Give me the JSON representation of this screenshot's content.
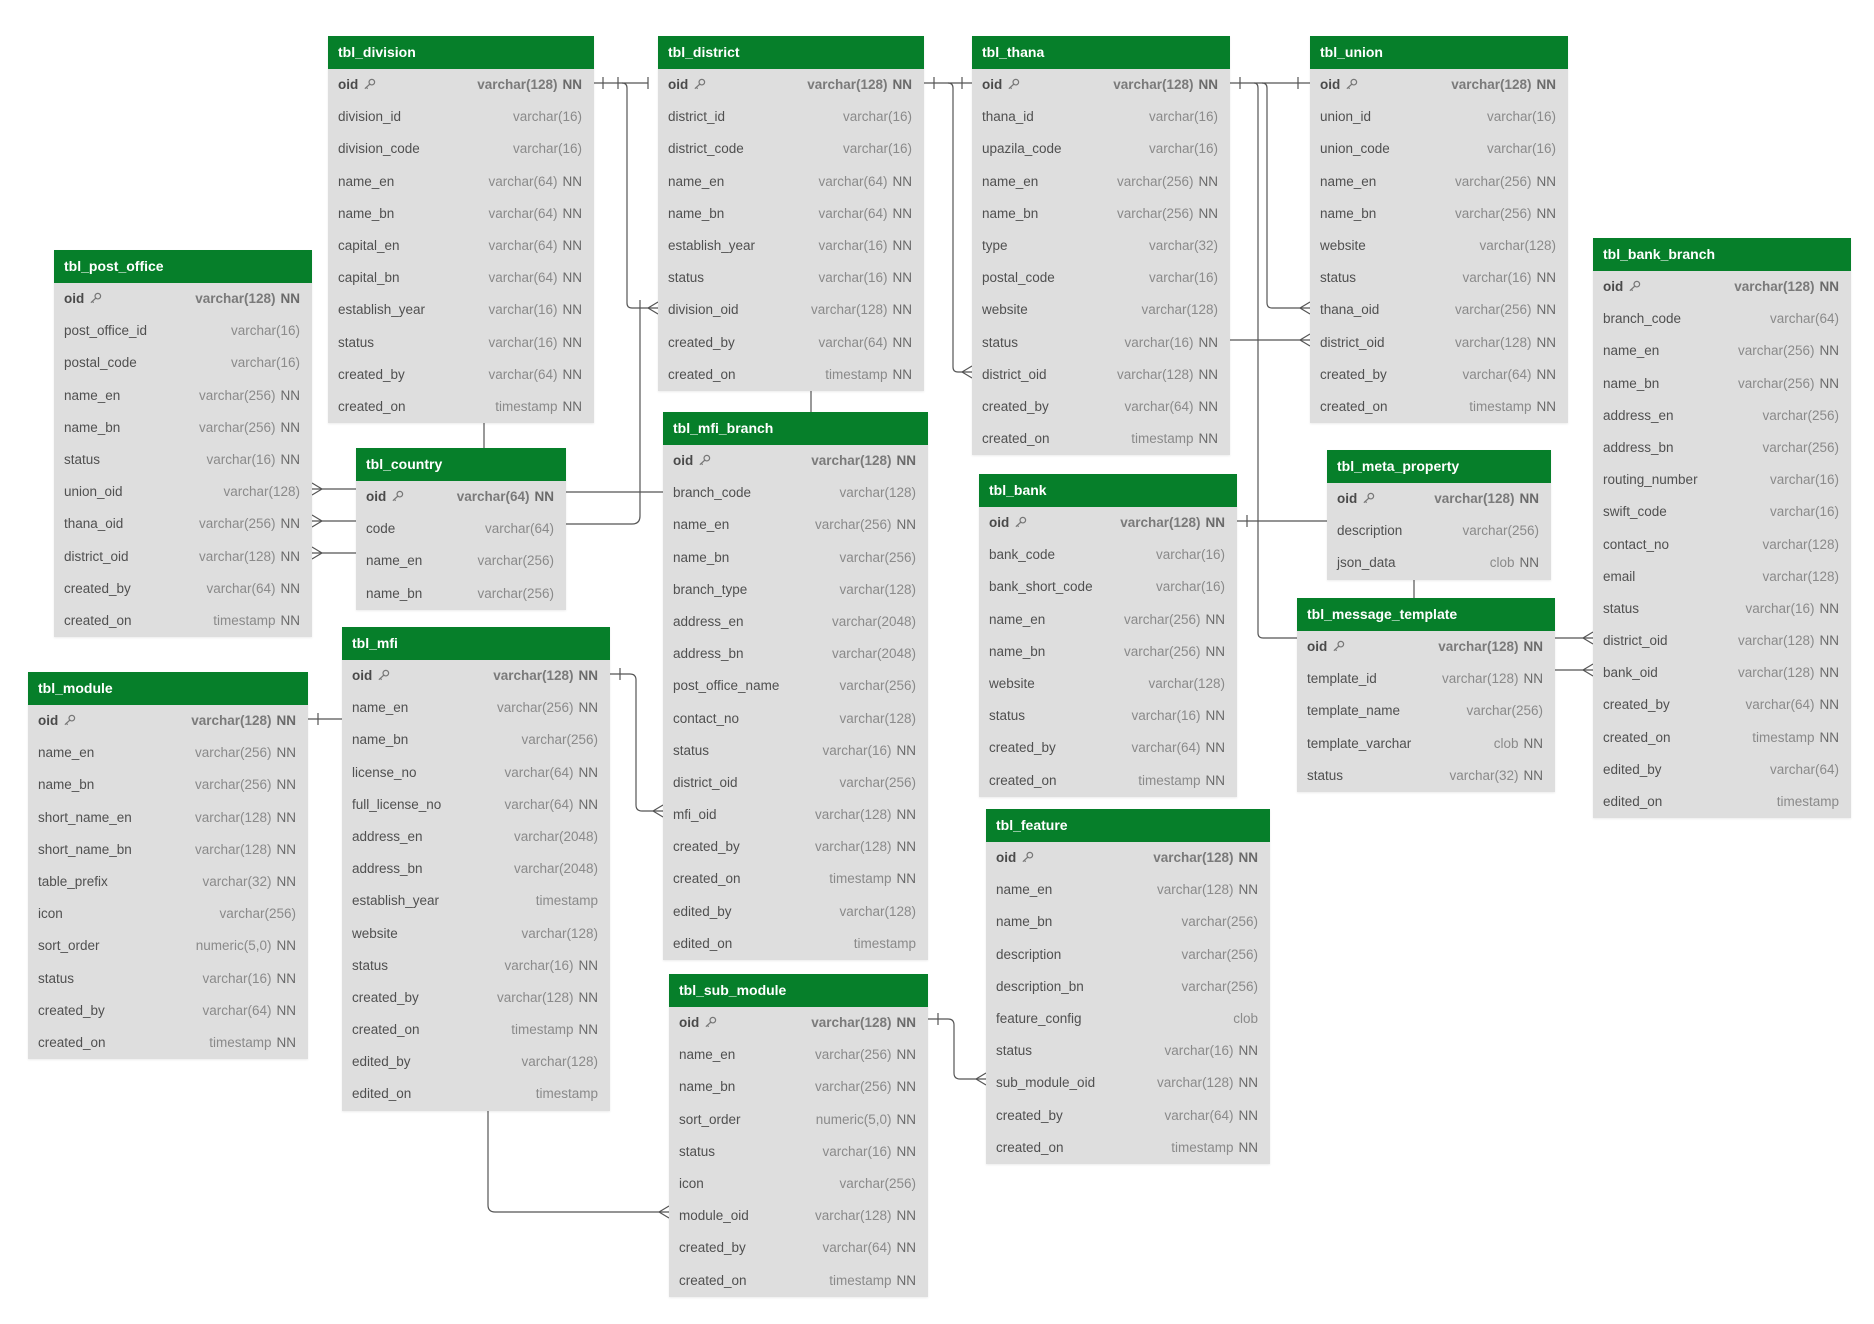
{
  "tables": [
    {
      "id": "tbl_division",
      "name": "tbl_division",
      "columns": [
        {
          "name": "oid",
          "type": "varchar(128)",
          "nn": "NN",
          "pk": true
        },
        {
          "name": "division_id",
          "type": "varchar(16)",
          "nn": ""
        },
        {
          "name": "division_code",
          "type": "varchar(16)",
          "nn": ""
        },
        {
          "name": "name_en",
          "type": "varchar(64)",
          "nn": "NN"
        },
        {
          "name": "name_bn",
          "type": "varchar(64)",
          "nn": "NN"
        },
        {
          "name": "capital_en",
          "type": "varchar(64)",
          "nn": "NN"
        },
        {
          "name": "capital_bn",
          "type": "varchar(64)",
          "nn": "NN"
        },
        {
          "name": "establish_year",
          "type": "varchar(16)",
          "nn": "NN"
        },
        {
          "name": "status",
          "type": "varchar(16)",
          "nn": "NN"
        },
        {
          "name": "created_by",
          "type": "varchar(64)",
          "nn": "NN"
        },
        {
          "name": "created_on",
          "type": "timestamp",
          "nn": "NN"
        }
      ]
    },
    {
      "id": "tbl_district",
      "name": "tbl_district",
      "columns": [
        {
          "name": "oid",
          "type": "varchar(128)",
          "nn": "NN",
          "pk": true
        },
        {
          "name": "district_id",
          "type": "varchar(16)",
          "nn": ""
        },
        {
          "name": "district_code",
          "type": "varchar(16)",
          "nn": ""
        },
        {
          "name": "name_en",
          "type": "varchar(64)",
          "nn": "NN"
        },
        {
          "name": "name_bn",
          "type": "varchar(64)",
          "nn": "NN"
        },
        {
          "name": "establish_year",
          "type": "varchar(16)",
          "nn": "NN"
        },
        {
          "name": "status",
          "type": "varchar(16)",
          "nn": "NN"
        },
        {
          "name": "division_oid",
          "type": "varchar(128)",
          "nn": "NN"
        },
        {
          "name": "created_by",
          "type": "varchar(64)",
          "nn": "NN"
        },
        {
          "name": "created_on",
          "type": "timestamp",
          "nn": "NN"
        }
      ]
    },
    {
      "id": "tbl_thana",
      "name": "tbl_thana",
      "columns": [
        {
          "name": "oid",
          "type": "varchar(128)",
          "nn": "NN",
          "pk": true
        },
        {
          "name": "thana_id",
          "type": "varchar(16)",
          "nn": ""
        },
        {
          "name": "upazila_code",
          "type": "varchar(16)",
          "nn": ""
        },
        {
          "name": "name_en",
          "type": "varchar(256)",
          "nn": "NN"
        },
        {
          "name": "name_bn",
          "type": "varchar(256)",
          "nn": "NN"
        },
        {
          "name": "type",
          "type": "varchar(32)",
          "nn": ""
        },
        {
          "name": "postal_code",
          "type": "varchar(16)",
          "nn": ""
        },
        {
          "name": "website",
          "type": "varchar(128)",
          "nn": ""
        },
        {
          "name": "status",
          "type": "varchar(16)",
          "nn": "NN"
        },
        {
          "name": "district_oid",
          "type": "varchar(128)",
          "nn": "NN"
        },
        {
          "name": "created_by",
          "type": "varchar(64)",
          "nn": "NN"
        },
        {
          "name": "created_on",
          "type": "timestamp",
          "nn": "NN"
        }
      ]
    },
    {
      "id": "tbl_union",
      "name": "tbl_union",
      "columns": [
        {
          "name": "oid",
          "type": "varchar(128)",
          "nn": "NN",
          "pk": true
        },
        {
          "name": "union_id",
          "type": "varchar(16)",
          "nn": ""
        },
        {
          "name": "union_code",
          "type": "varchar(16)",
          "nn": ""
        },
        {
          "name": "name_en",
          "type": "varchar(256)",
          "nn": "NN"
        },
        {
          "name": "name_bn",
          "type": "varchar(256)",
          "nn": "NN"
        },
        {
          "name": "website",
          "type": "varchar(128)",
          "nn": ""
        },
        {
          "name": "status",
          "type": "varchar(16)",
          "nn": "NN"
        },
        {
          "name": "thana_oid",
          "type": "varchar(256)",
          "nn": "NN"
        },
        {
          "name": "district_oid",
          "type": "varchar(128)",
          "nn": "NN"
        },
        {
          "name": "created_by",
          "type": "varchar(64)",
          "nn": "NN"
        },
        {
          "name": "created_on",
          "type": "timestamp",
          "nn": "NN"
        }
      ]
    },
    {
      "id": "tbl_post_office",
      "name": "tbl_post_office",
      "columns": [
        {
          "name": "oid",
          "type": "varchar(128)",
          "nn": "NN",
          "pk": true
        },
        {
          "name": "post_office_id",
          "type": "varchar(16)",
          "nn": ""
        },
        {
          "name": "postal_code",
          "type": "varchar(16)",
          "nn": ""
        },
        {
          "name": "name_en",
          "type": "varchar(256)",
          "nn": "NN"
        },
        {
          "name": "name_bn",
          "type": "varchar(256)",
          "nn": "NN"
        },
        {
          "name": "status",
          "type": "varchar(16)",
          "nn": "NN"
        },
        {
          "name": "union_oid",
          "type": "varchar(128)",
          "nn": ""
        },
        {
          "name": "thana_oid",
          "type": "varchar(256)",
          "nn": "NN"
        },
        {
          "name": "district_oid",
          "type": "varchar(128)",
          "nn": "NN"
        },
        {
          "name": "created_by",
          "type": "varchar(64)",
          "nn": "NN"
        },
        {
          "name": "created_on",
          "type": "timestamp",
          "nn": "NN"
        }
      ]
    },
    {
      "id": "tbl_country",
      "name": "tbl_country",
      "columns": [
        {
          "name": "oid",
          "type": "varchar(64)",
          "nn": "NN",
          "pk": true
        },
        {
          "name": "code",
          "type": "varchar(64)",
          "nn": ""
        },
        {
          "name": "name_en",
          "type": "varchar(256)",
          "nn": ""
        },
        {
          "name": "name_bn",
          "type": "varchar(256)",
          "nn": ""
        }
      ]
    },
    {
      "id": "tbl_mfi_branch",
      "name": "tbl_mfi_branch",
      "columns": [
        {
          "name": "oid",
          "type": "varchar(128)",
          "nn": "NN",
          "pk": true
        },
        {
          "name": "branch_code",
          "type": "varchar(128)",
          "nn": ""
        },
        {
          "name": "name_en",
          "type": "varchar(256)",
          "nn": "NN"
        },
        {
          "name": "name_bn",
          "type": "varchar(256)",
          "nn": ""
        },
        {
          "name": "branch_type",
          "type": "varchar(128)",
          "nn": ""
        },
        {
          "name": "address_en",
          "type": "varchar(2048)",
          "nn": ""
        },
        {
          "name": "address_bn",
          "type": "varchar(2048)",
          "nn": ""
        },
        {
          "name": "post_office_name",
          "type": "varchar(256)",
          "nn": ""
        },
        {
          "name": "contact_no",
          "type": "varchar(128)",
          "nn": ""
        },
        {
          "name": "status",
          "type": "varchar(16)",
          "nn": "NN"
        },
        {
          "name": "district_oid",
          "type": "varchar(256)",
          "nn": ""
        },
        {
          "name": "mfi_oid",
          "type": "varchar(128)",
          "nn": "NN"
        },
        {
          "name": "created_by",
          "type": "varchar(128)",
          "nn": "NN"
        },
        {
          "name": "created_on",
          "type": "timestamp",
          "nn": "NN"
        },
        {
          "name": "edited_by",
          "type": "varchar(128)",
          "nn": ""
        },
        {
          "name": "edited_on",
          "type": "timestamp",
          "nn": ""
        }
      ]
    },
    {
      "id": "tbl_bank",
      "name": "tbl_bank",
      "columns": [
        {
          "name": "oid",
          "type": "varchar(128)",
          "nn": "NN",
          "pk": true
        },
        {
          "name": "bank_code",
          "type": "varchar(16)",
          "nn": ""
        },
        {
          "name": "bank_short_code",
          "type": "varchar(16)",
          "nn": ""
        },
        {
          "name": "name_en",
          "type": "varchar(256)",
          "nn": "NN"
        },
        {
          "name": "name_bn",
          "type": "varchar(256)",
          "nn": "NN"
        },
        {
          "name": "website",
          "type": "varchar(128)",
          "nn": ""
        },
        {
          "name": "status",
          "type": "varchar(16)",
          "nn": "NN"
        },
        {
          "name": "created_by",
          "type": "varchar(64)",
          "nn": "NN"
        },
        {
          "name": "created_on",
          "type": "timestamp",
          "nn": "NN"
        }
      ]
    },
    {
      "id": "tbl_meta_property",
      "name": "tbl_meta_property",
      "columns": [
        {
          "name": "oid",
          "type": "varchar(128)",
          "nn": "NN",
          "pk": true
        },
        {
          "name": "description",
          "type": "varchar(256)",
          "nn": ""
        },
        {
          "name": "json_data",
          "type": "clob",
          "nn": "NN"
        }
      ]
    },
    {
      "id": "tbl_bank_branch",
      "name": "tbl_bank_branch",
      "columns": [
        {
          "name": "oid",
          "type": "varchar(128)",
          "nn": "NN",
          "pk": true
        },
        {
          "name": "branch_code",
          "type": "varchar(64)",
          "nn": ""
        },
        {
          "name": "name_en",
          "type": "varchar(256)",
          "nn": "NN"
        },
        {
          "name": "name_bn",
          "type": "varchar(256)",
          "nn": "NN"
        },
        {
          "name": "address_en",
          "type": "varchar(256)",
          "nn": ""
        },
        {
          "name": "address_bn",
          "type": "varchar(256)",
          "nn": ""
        },
        {
          "name": "routing_number",
          "type": "varchar(16)",
          "nn": ""
        },
        {
          "name": "swift_code",
          "type": "varchar(16)",
          "nn": ""
        },
        {
          "name": "contact_no",
          "type": "varchar(128)",
          "nn": ""
        },
        {
          "name": "email",
          "type": "varchar(128)",
          "nn": ""
        },
        {
          "name": "status",
          "type": "varchar(16)",
          "nn": "NN"
        },
        {
          "name": "district_oid",
          "type": "varchar(128)",
          "nn": "NN"
        },
        {
          "name": "bank_oid",
          "type": "varchar(128)",
          "nn": "NN"
        },
        {
          "name": "created_by",
          "type": "varchar(64)",
          "nn": "NN"
        },
        {
          "name": "created_on",
          "type": "timestamp",
          "nn": "NN"
        },
        {
          "name": "edited_by",
          "type": "varchar(64)",
          "nn": ""
        },
        {
          "name": "edited_on",
          "type": "timestamp",
          "nn": ""
        }
      ]
    },
    {
      "id": "tbl_message_template",
      "name": "tbl_message_template",
      "columns": [
        {
          "name": "oid",
          "type": "varchar(128)",
          "nn": "NN",
          "pk": true
        },
        {
          "name": "template_id",
          "type": "varchar(128)",
          "nn": "NN"
        },
        {
          "name": "template_name",
          "type": "varchar(256)",
          "nn": ""
        },
        {
          "name": "template_varchar",
          "type": "clob",
          "nn": "NN"
        },
        {
          "name": "status",
          "type": "varchar(32)",
          "nn": "NN"
        }
      ]
    },
    {
      "id": "tbl_module",
      "name": "tbl_module",
      "columns": [
        {
          "name": "oid",
          "type": "varchar(128)",
          "nn": "NN",
          "pk": true
        },
        {
          "name": "name_en",
          "type": "varchar(256)",
          "nn": "NN"
        },
        {
          "name": "name_bn",
          "type": "varchar(256)",
          "nn": "NN"
        },
        {
          "name": "short_name_en",
          "type": "varchar(128)",
          "nn": "NN"
        },
        {
          "name": "short_name_bn",
          "type": "varchar(128)",
          "nn": "NN"
        },
        {
          "name": "table_prefix",
          "type": "varchar(32)",
          "nn": "NN"
        },
        {
          "name": "icon",
          "type": "varchar(256)",
          "nn": ""
        },
        {
          "name": "sort_order",
          "type": "numeric(5,0)",
          "nn": "NN"
        },
        {
          "name": "status",
          "type": "varchar(16)",
          "nn": "NN"
        },
        {
          "name": "created_by",
          "type": "varchar(64)",
          "nn": "NN"
        },
        {
          "name": "created_on",
          "type": "timestamp",
          "nn": "NN"
        }
      ]
    },
    {
      "id": "tbl_mfi",
      "name": "tbl_mfi",
      "columns": [
        {
          "name": "oid",
          "type": "varchar(128)",
          "nn": "NN",
          "pk": true
        },
        {
          "name": "name_en",
          "type": "varchar(256)",
          "nn": "NN"
        },
        {
          "name": "name_bn",
          "type": "varchar(256)",
          "nn": ""
        },
        {
          "name": "license_no",
          "type": "varchar(64)",
          "nn": "NN"
        },
        {
          "name": "full_license_no",
          "type": "varchar(64)",
          "nn": "NN"
        },
        {
          "name": "address_en",
          "type": "varchar(2048)",
          "nn": ""
        },
        {
          "name": "address_bn",
          "type": "varchar(2048)",
          "nn": ""
        },
        {
          "name": "establish_year",
          "type": "timestamp",
          "nn": ""
        },
        {
          "name": "website",
          "type": "varchar(128)",
          "nn": ""
        },
        {
          "name": "status",
          "type": "varchar(16)",
          "nn": "NN"
        },
        {
          "name": "created_by",
          "type": "varchar(128)",
          "nn": "NN"
        },
        {
          "name": "created_on",
          "type": "timestamp",
          "nn": "NN"
        },
        {
          "name": "edited_by",
          "type": "varchar(128)",
          "nn": ""
        },
        {
          "name": "edited_on",
          "type": "timestamp",
          "nn": ""
        }
      ]
    },
    {
      "id": "tbl_feature",
      "name": "tbl_feature",
      "columns": [
        {
          "name": "oid",
          "type": "varchar(128)",
          "nn": "NN",
          "pk": true
        },
        {
          "name": "name_en",
          "type": "varchar(128)",
          "nn": "NN"
        },
        {
          "name": "name_bn",
          "type": "varchar(256)",
          "nn": ""
        },
        {
          "name": "description",
          "type": "varchar(256)",
          "nn": ""
        },
        {
          "name": "description_bn",
          "type": "varchar(256)",
          "nn": ""
        },
        {
          "name": "feature_config",
          "type": "clob",
          "nn": ""
        },
        {
          "name": "status",
          "type": "varchar(16)",
          "nn": "NN"
        },
        {
          "name": "sub_module_oid",
          "type": "varchar(128)",
          "nn": "NN"
        },
        {
          "name": "created_by",
          "type": "varchar(64)",
          "nn": "NN"
        },
        {
          "name": "created_on",
          "type": "timestamp",
          "nn": "NN"
        }
      ]
    },
    {
      "id": "tbl_sub_module",
      "name": "tbl_sub_module",
      "columns": [
        {
          "name": "oid",
          "type": "varchar(128)",
          "nn": "NN",
          "pk": true
        },
        {
          "name": "name_en",
          "type": "varchar(256)",
          "nn": "NN"
        },
        {
          "name": "name_bn",
          "type": "varchar(256)",
          "nn": "NN"
        },
        {
          "name": "sort_order",
          "type": "numeric(5,0)",
          "nn": "NN"
        },
        {
          "name": "status",
          "type": "varchar(16)",
          "nn": "NN"
        },
        {
          "name": "icon",
          "type": "varchar(256)",
          "nn": ""
        },
        {
          "name": "module_oid",
          "type": "varchar(128)",
          "nn": "NN"
        },
        {
          "name": "created_by",
          "type": "varchar(64)",
          "nn": "NN"
        },
        {
          "name": "created_on",
          "type": "timestamp",
          "nn": "NN"
        }
      ]
    }
  ],
  "relationships": [
    {
      "from_table": "tbl_division",
      "from_column": "oid",
      "to_table": "tbl_district",
      "to_column": "division_oid"
    },
    {
      "from_table": "tbl_district",
      "from_column": "oid",
      "to_table": "tbl_thana",
      "to_column": "district_oid"
    },
    {
      "from_table": "tbl_thana",
      "from_column": "oid",
      "to_table": "tbl_union",
      "to_column": "thana_oid"
    },
    {
      "from_table": "tbl_district",
      "from_column": "oid",
      "to_table": "tbl_union",
      "to_column": "district_oid"
    },
    {
      "from_table": "tbl_union",
      "from_column": "oid",
      "to_table": "tbl_post_office",
      "to_column": "union_oid"
    },
    {
      "from_table": "tbl_thana",
      "from_column": "oid",
      "to_table": "tbl_post_office",
      "to_column": "thana_oid"
    },
    {
      "from_table": "tbl_district",
      "from_column": "oid",
      "to_table": "tbl_post_office",
      "to_column": "district_oid"
    },
    {
      "from_table": "tbl_mfi",
      "from_column": "oid",
      "to_table": "tbl_mfi_branch",
      "to_column": "mfi_oid"
    },
    {
      "from_table": "tbl_module",
      "from_column": "oid",
      "to_table": "tbl_sub_module",
      "to_column": "module_oid"
    },
    {
      "from_table": "tbl_sub_module",
      "from_column": "oid",
      "to_table": "tbl_feature",
      "to_column": "sub_module_oid"
    },
    {
      "from_table": "tbl_bank",
      "from_column": "oid",
      "to_table": "tbl_bank_branch",
      "to_column": "bank_oid"
    },
    {
      "from_table": "tbl_thana",
      "from_column": "oid",
      "to_table": "tbl_bank_branch",
      "to_column": "district_oid"
    }
  ],
  "colors": {
    "header": "#067f2a",
    "body": "#dedede",
    "line": "#555555"
  }
}
